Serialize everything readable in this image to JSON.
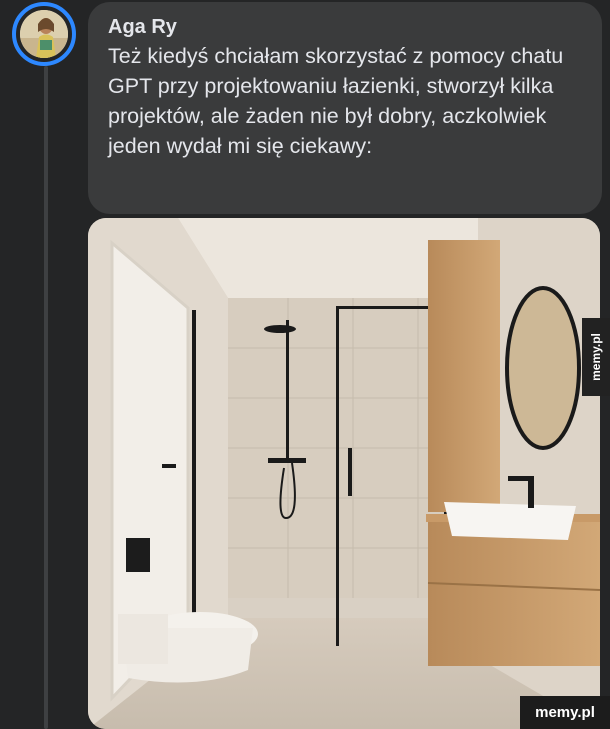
{
  "post": {
    "author_name": "Aga Ry",
    "comment_text": "Też kiedyś chciałam skorzystać z pomocy chatu GPT przy projektowaniu łazienki, stworzył kilka projektów, ale żaden nie był dobry, aczkolwiek jeden wydał mi się ciekawy:"
  },
  "watermarks": {
    "side": "memy.pl",
    "bottom": "memy.pl"
  },
  "colors": {
    "background": "#242526",
    "bubble": "#3a3b3c",
    "text": "#e4e6eb",
    "avatar_ring": "#2d88ff"
  }
}
